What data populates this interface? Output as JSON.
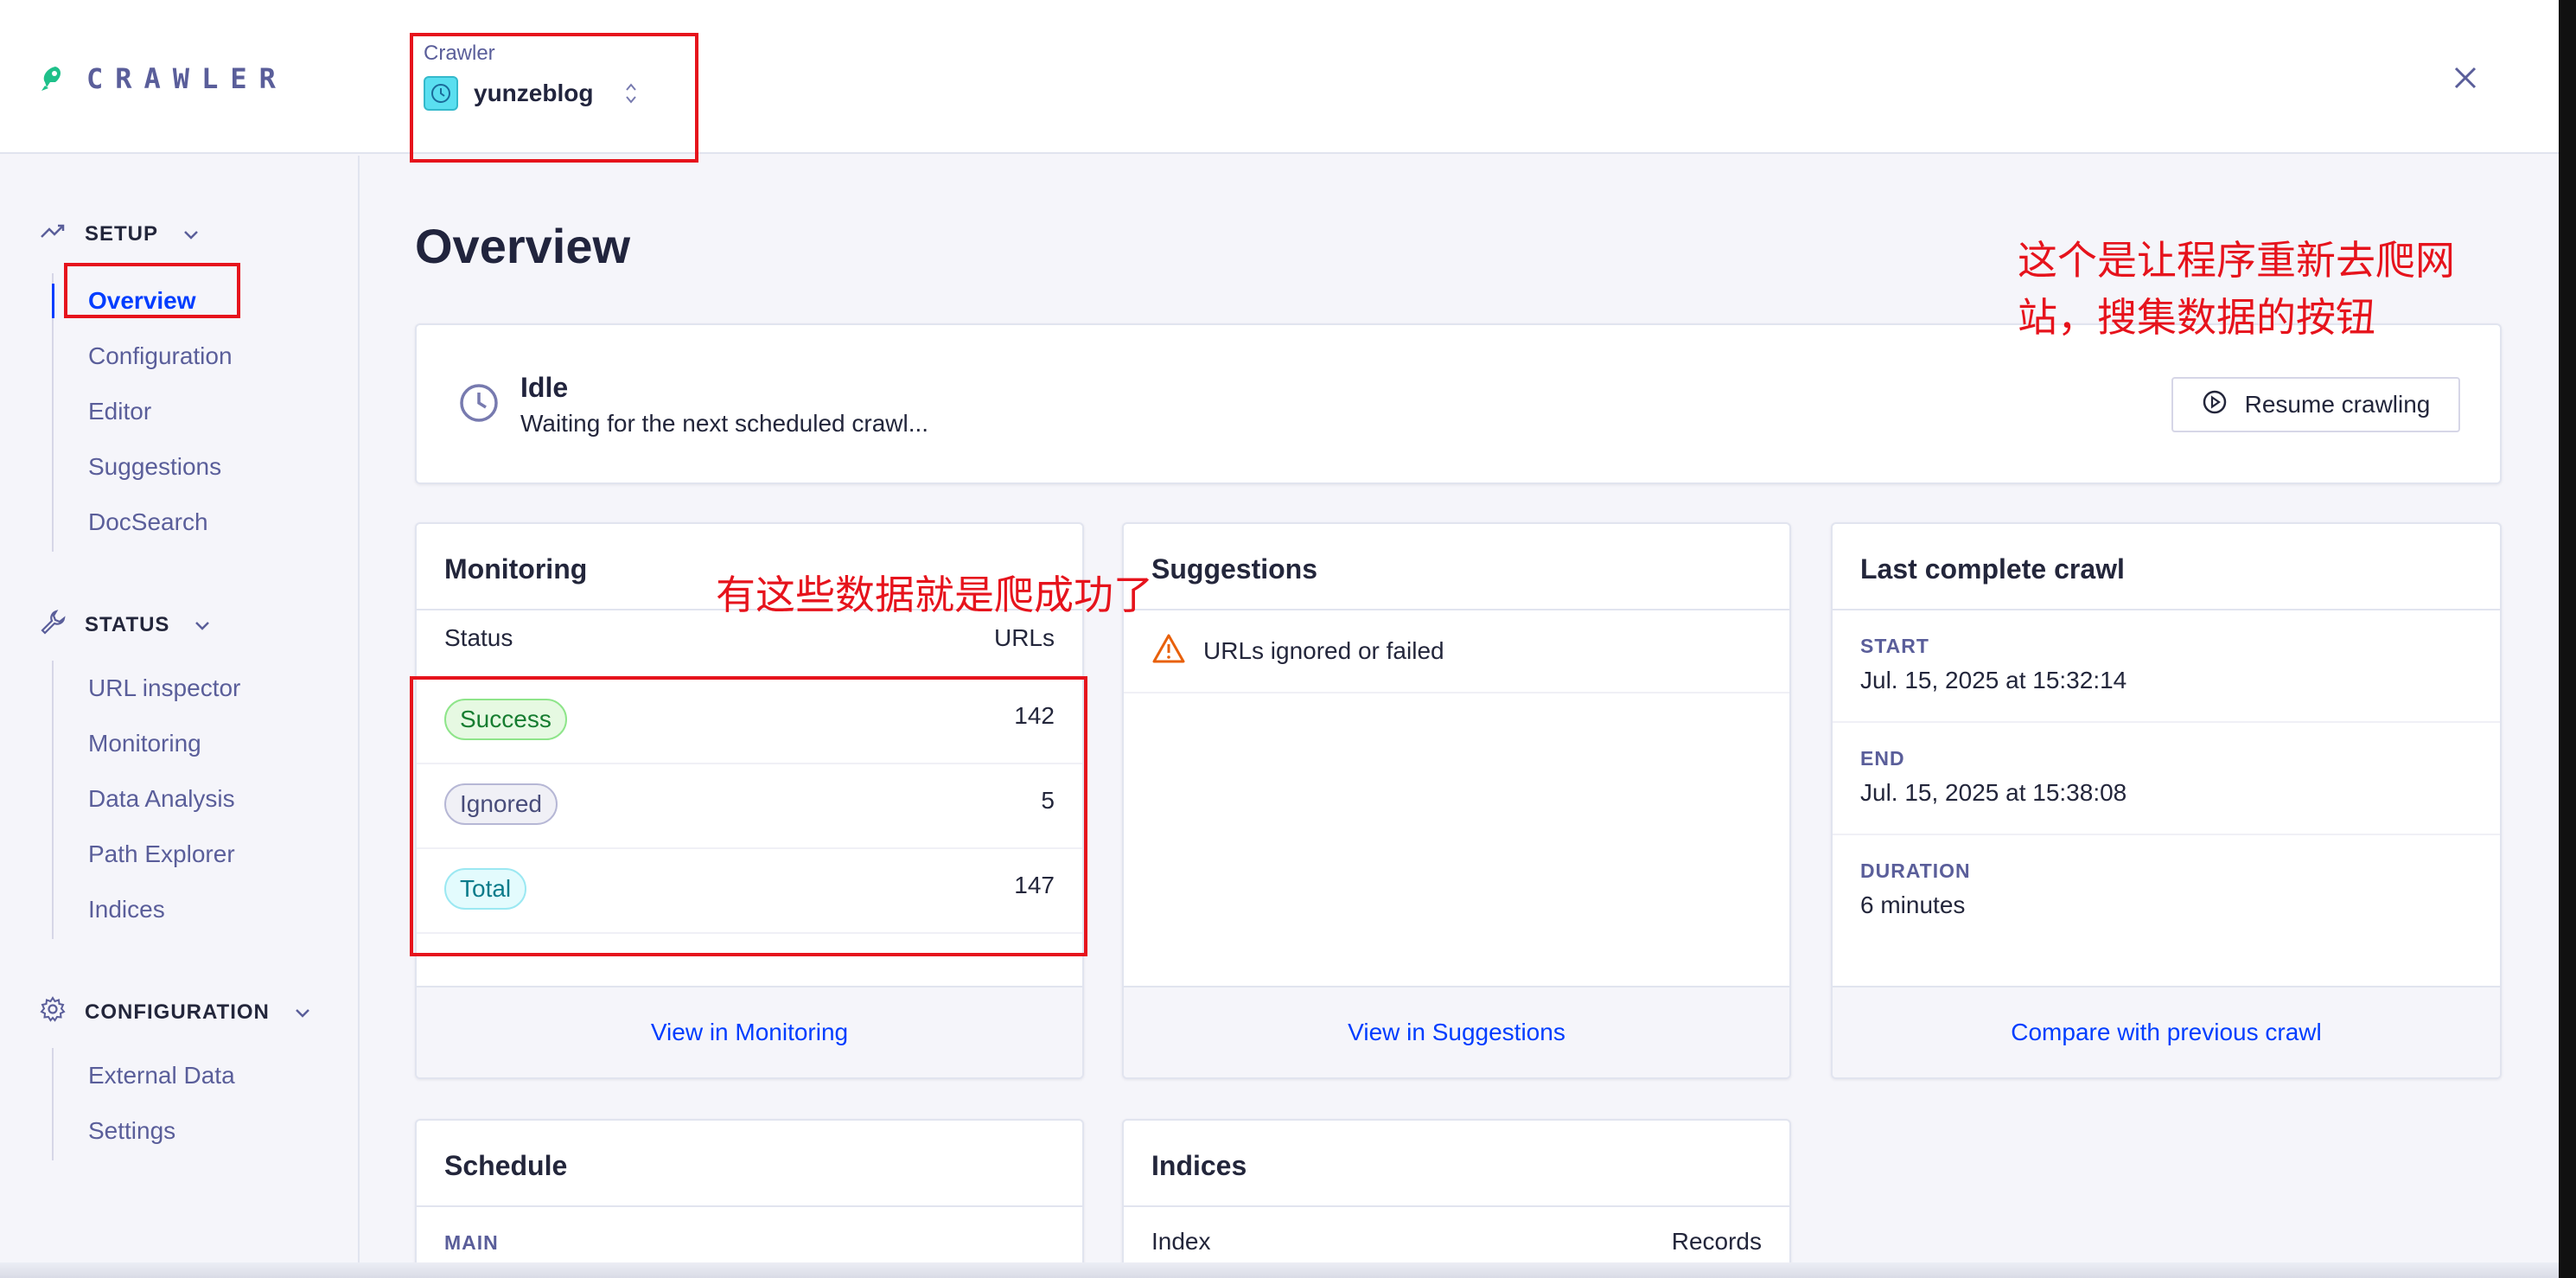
{
  "header": {
    "logo_text": "CRAWLER",
    "crawler_label": "Crawler",
    "crawler_name": "yunzeblog"
  },
  "sidebar": {
    "sections": [
      {
        "title": "SETUP",
        "items": [
          "Overview",
          "Configuration",
          "Editor",
          "Suggestions",
          "DocSearch"
        ]
      },
      {
        "title": "STATUS",
        "items": [
          "URL inspector",
          "Monitoring",
          "Data Analysis",
          "Path Explorer",
          "Indices"
        ]
      },
      {
        "title": "CONFIGURATION",
        "items": [
          "External Data",
          "Settings"
        ]
      }
    ],
    "active_item": "Overview"
  },
  "main": {
    "title": "Overview",
    "status": {
      "title": "Idle",
      "subtitle": "Waiting for the next scheduled crawl...",
      "resume_label": "Resume crawling"
    },
    "monitoring": {
      "title": "Monitoring",
      "col_status": "Status",
      "col_urls": "URLs",
      "rows": [
        {
          "label": "Success",
          "value": "142"
        },
        {
          "label": "Ignored",
          "value": "5"
        },
        {
          "label": "Total",
          "value": "147"
        }
      ],
      "footer_link": "View in Monitoring"
    },
    "suggestions": {
      "title": "Suggestions",
      "item": "URLs ignored or failed",
      "footer_link": "View in Suggestions"
    },
    "last_crawl": {
      "title": "Last complete crawl",
      "start_label": "START",
      "start_value": "Jul. 15, 2025 at 15:32:14",
      "end_label": "END",
      "end_value": "Jul. 15, 2025 at 15:38:08",
      "duration_label": "DURATION",
      "duration_value": "6 minutes",
      "footer_link": "Compare with previous crawl"
    },
    "schedule": {
      "title": "Schedule",
      "first_label": "MAIN"
    },
    "indices": {
      "title": "Indices",
      "col_index": "Index",
      "col_records": "Records"
    }
  },
  "annotations": {
    "resume_note_line1": "这个是让程序重新去爬网",
    "resume_note_line2": "站，搜集数据的按钮",
    "monitoring_note": "有这些数据就是爬成功了"
  },
  "colors": {
    "accent": "#003dff",
    "annotation_red": "#e6131c",
    "success_green": "#177d31"
  }
}
